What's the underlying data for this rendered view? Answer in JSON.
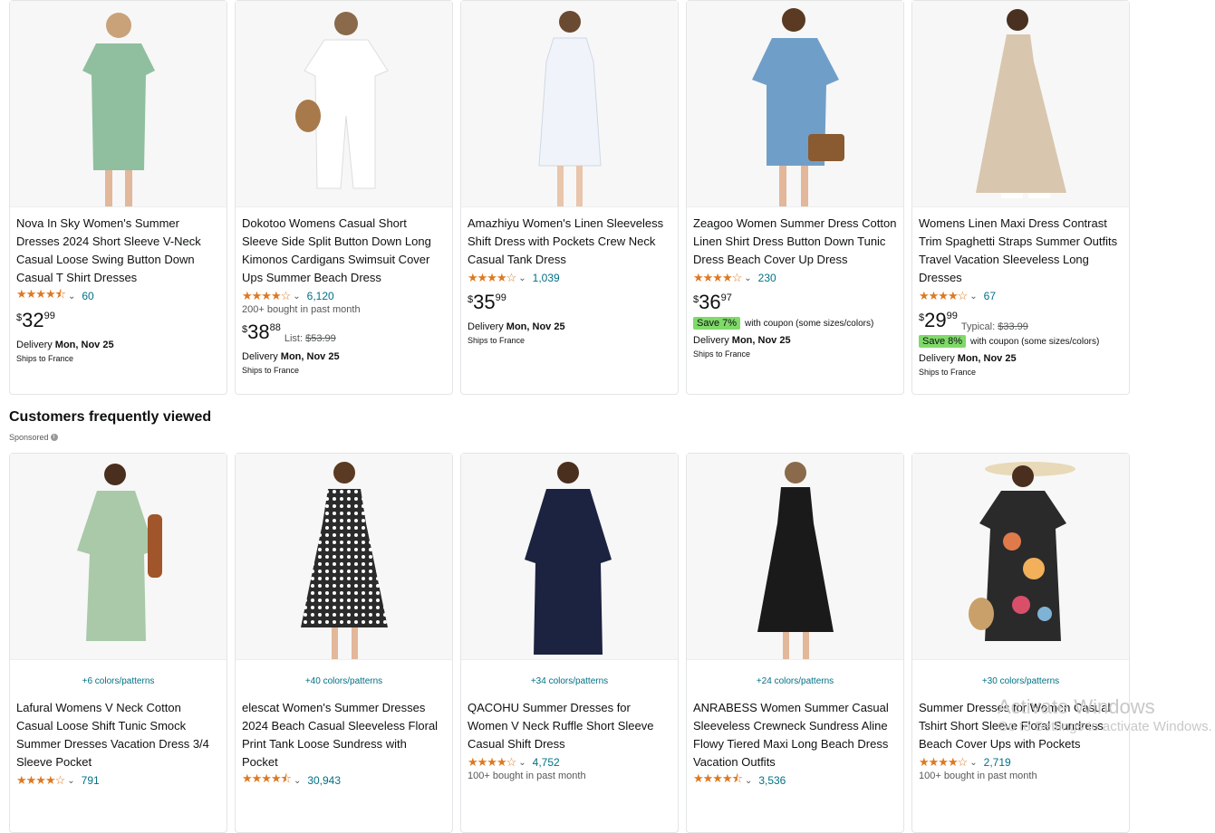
{
  "top_products": [
    {
      "title": "Nova In Sky Women's Summer Dresses 2024 Short Sleeve V-Neck Casual Loose Swing Button Down Casual T Shirt Dresses",
      "stars": "★★★★⯪",
      "rating_count": "60",
      "price_symbol": "$",
      "price_whole": "32",
      "price_fraction": "99",
      "delivery_label": "Delivery",
      "delivery_date": "Mon, Nov 25",
      "ships": "Ships to France",
      "image_color": "#8fbf9f"
    },
    {
      "title": "Dokotoo Womens Casual Short Sleeve Side Split Button Down Long Kimonos Cardigans Swimsuit Cover Ups Summer Beach Dress",
      "stars": "★★★★☆",
      "rating_count": "6,120",
      "bought": "200+ bought in past month",
      "price_symbol": "$",
      "price_whole": "38",
      "price_fraction": "88",
      "list_label": "List:",
      "list_price": "$53.99",
      "delivery_label": "Delivery",
      "delivery_date": "Mon, Nov 25",
      "ships": "Ships to France",
      "image_color": "#f6f6f6"
    },
    {
      "title": "Amazhiyu Women's Linen Sleeveless Shift Dress with Pockets Crew Neck Casual Tank Dress",
      "stars": "★★★★☆",
      "rating_count": "1,039",
      "price_symbol": "$",
      "price_whole": "35",
      "price_fraction": "99",
      "delivery_label": "Delivery",
      "delivery_date": "Mon, Nov 25",
      "ships": "Ships to France",
      "image_color": "#f0f4fa"
    },
    {
      "title": "Zeagoo Women Summer Dress Cotton Linen Shirt Dress Button Down Tunic Dress Beach Cover Up Dress",
      "stars": "★★★★☆",
      "rating_count": "230",
      "price_symbol": "$",
      "price_whole": "36",
      "price_fraction": "97",
      "save_badge": "Save 7%",
      "coupon_text": "with coupon (some sizes/colors)",
      "delivery_label": "Delivery",
      "delivery_date": "Mon, Nov 25",
      "ships": "Ships to France",
      "image_color": "#6f9fc8"
    },
    {
      "title": "Womens Linen Maxi Dress Contrast Trim Spaghetti Straps Summer Outfits Travel Vacation Sleeveless Long Dresses",
      "stars": "★★★★☆",
      "rating_count": "67",
      "price_symbol": "$",
      "price_whole": "29",
      "price_fraction": "99",
      "list_label": "Typical:",
      "list_price": "$33.99",
      "save_badge": "Save 8%",
      "coupon_text": "with coupon (some sizes/colors)",
      "delivery_label": "Delivery",
      "delivery_date": "Mon, Nov 25",
      "ships": "Ships to France",
      "image_color": "#d9c6ae"
    }
  ],
  "section": {
    "title": "Customers frequently viewed",
    "sponsored": "Sponsored"
  },
  "bottom_products": [
    {
      "swatch": "+6 colors/patterns",
      "title": "Lafural Womens V Neck Cotton Casual Loose Shift Tunic Smock Summer Dresses Vacation Dress 3/4 Sleeve Pocket",
      "stars": "★★★★☆",
      "rating_count": "791",
      "image_color": "#a9c9a8"
    },
    {
      "swatch": "+40 colors/patterns",
      "title": "elescat Women's Summer Dresses 2024 Beach Casual Sleeveless Floral Print Tank Loose Sundress with Pocket",
      "stars": "★★★★⯪",
      "rating_count": "30,943",
      "image_color": "#3a3a3a"
    },
    {
      "swatch": "+34 colors/patterns",
      "title": "QACOHU Summer Dresses for Women V Neck Ruffle Short Sleeve Casual Shift Dress",
      "stars": "★★★★☆",
      "rating_count": "4,752",
      "bought": "100+ bought in past month",
      "image_color": "#1c2340"
    },
    {
      "swatch": "+24 colors/patterns",
      "title": "ANRABESS Women Summer Casual Sleeveless Crewneck Sundress Aline Flowy Tiered Maxi Long Beach Dress Vacation Outfits",
      "stars": "★★★★⯪",
      "rating_count": "3,536",
      "image_color": "#1a1a1a"
    },
    {
      "swatch": "+30 colors/patterns",
      "title": "Summer Dresses for Women Casual Tshirt Short Sleeve Floral Sundress Beach Cover Ups with Pockets",
      "stars": "★★★★☆",
      "rating_count": "2,719",
      "bought": "100+ bought in past month",
      "image_color": "#2a2a2a"
    }
  ],
  "watermark": {
    "title": "Activate Windows",
    "subtitle": "Go to Settings to activate Windows."
  }
}
